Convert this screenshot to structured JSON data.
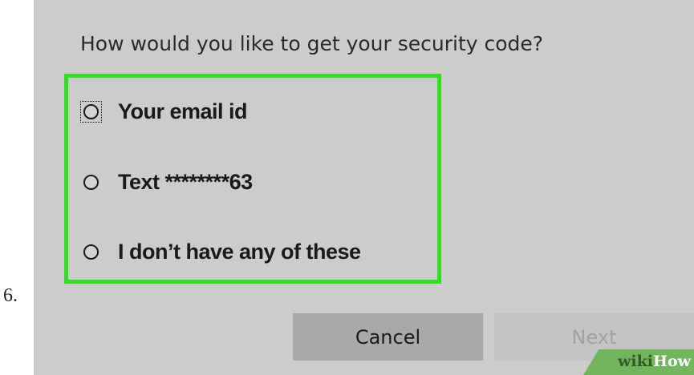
{
  "step_number": "6.",
  "dialog": {
    "question": "How would you like to get your security code?",
    "options": [
      {
        "label": "Your email id",
        "selected": false,
        "focused": true
      },
      {
        "label": "Text ********63",
        "selected": false,
        "focused": false
      },
      {
        "label": "I don’t have any  of these",
        "selected": false,
        "focused": false
      }
    ],
    "buttons": {
      "cancel_label": "Cancel",
      "next_label": "Next",
      "next_enabled": false
    }
  },
  "watermark": {
    "part1": "wiki",
    "part2": "How"
  },
  "colors": {
    "highlight": "#33dd22",
    "panel_background": "#cccccc",
    "watermark_green": "#72b55c"
  }
}
